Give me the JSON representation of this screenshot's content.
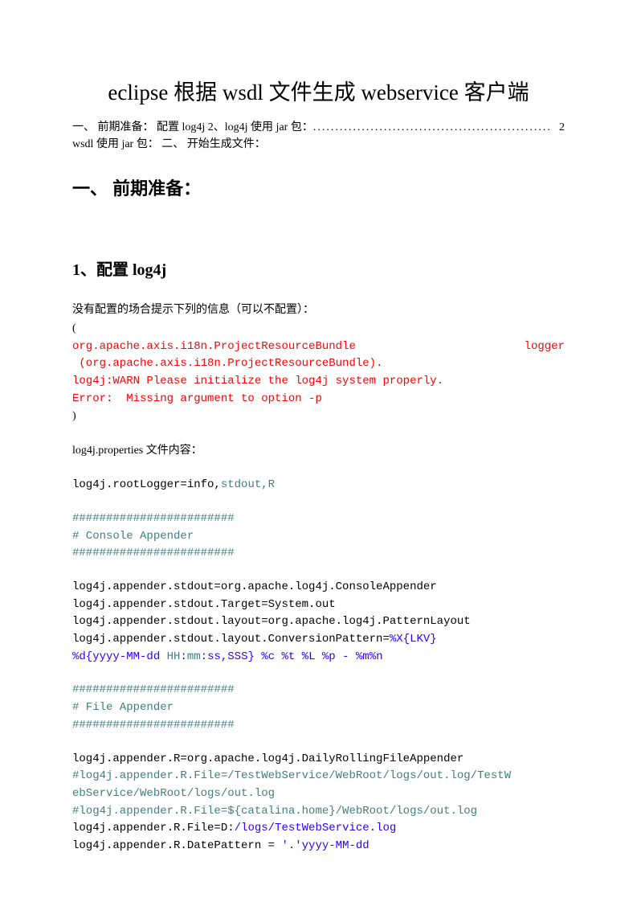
{
  "title": "eclipse 根据 wsdl 文件生成 webservice 客户端",
  "toc": {
    "line1_left": "一、 前期准备：  配置 log4j     2、log4j 使用 jar 包：",
    "line1_dots": "......................................................",
    "line1_page": "2",
    "line2": "wsdl 使用 jar 包： 二、 开始生成文件："
  },
  "h2": "一、 前期准备：",
  "h3": "1、配置 log4j",
  "para1": "没有配置的场合提示下列的信息（可以不配置）：",
  "open_paren": "(",
  "err_l1a": "org.apache.axis.i18n.ProjectResourceBundle",
  "err_l1b": "logger",
  "err_l2": " (org.apache.axis.i18n.ProjectResourceBundle).",
  "err_l3": "log4j:WARN Please initialize the log4j system properly.",
  "err_l4": "Error:  Missing argument to option -p",
  "close_paren": ")",
  "para2": "log4j.properties 文件内容：",
  "cfg_l1a": "log4j.rootLogger=info,",
  "cfg_l1b": "stdout,R",
  "hash1": "########################",
  "comment1": "# Console Appender",
  "hash2": "########################",
  "cfg_l2": "log4j.appender.stdout=org.apache.log4j.ConsoleAppender",
  "cfg_l3": "log4j.appender.stdout.Target=System.out",
  "cfg_l4": "log4j.appender.stdout.layout=org.apache.log4j.PatternLayout",
  "cfg_l5a": "log4j.appender.stdout.layout.ConversionPattern=",
  "cfg_l5b": "%X{LKV}",
  "cfg_l6a": "%d{yyyy-MM-dd",
  "cfg_l6b": " HH",
  "cfg_l6c": ":",
  "cfg_l6d": "mm",
  "cfg_l6e": ":",
  "cfg_l6f": "ss,SSS} %c %t %L %p - %m%n",
  "hash3": "########################",
  "comment2": "# File Appender",
  "hash4": "########################",
  "cfg_l7": "log4j.appender.R=org.apache.log4j.DailyRollingFileAppender",
  "cfg_l8": "#log4j.appender.R.File=/TestWebService/WebRoot/logs/out.log/TestW",
  "cfg_l9": "ebService/WebRoot/logs/out.log",
  "cfg_l10": "#log4j.appender.R.File=${catalina.home}/WebRoot/logs/out.log",
  "cfg_l11a": "log4j.appender.R.File=D:",
  "cfg_l11b": "/logs/TestWebService.log",
  "cfg_l12a": "log4j.appender.R.DatePattern = ",
  "cfg_l12b": "'.'yyyy-MM-dd"
}
